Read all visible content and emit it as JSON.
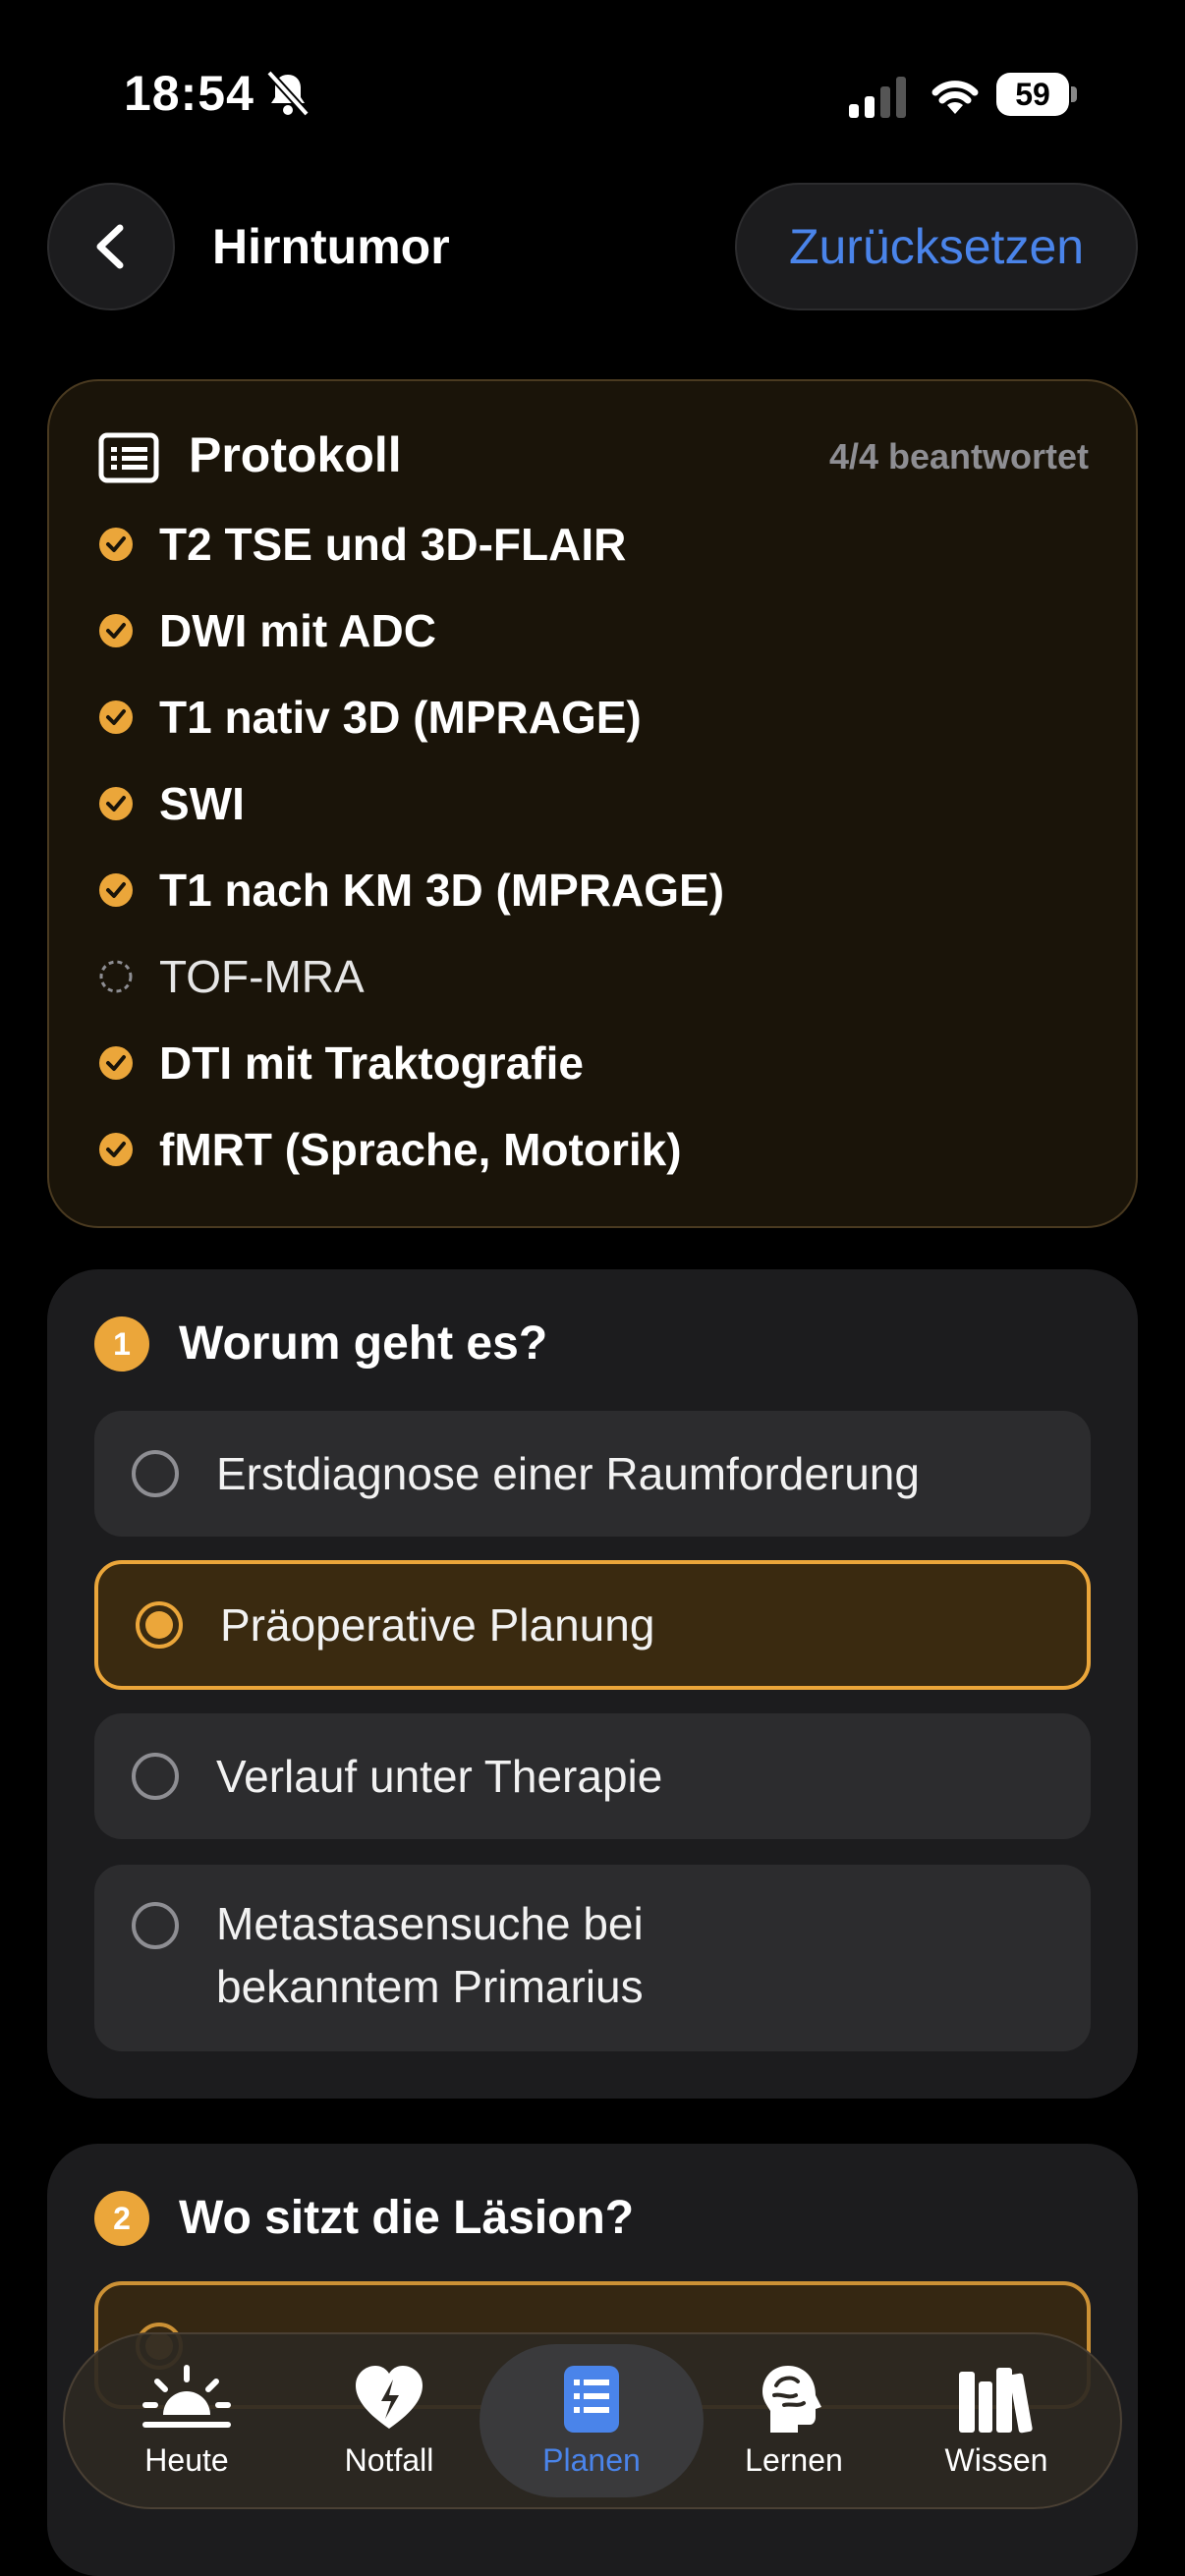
{
  "status_bar": {
    "time": "18:54",
    "battery": "59"
  },
  "nav": {
    "title": "Hirntumor",
    "reset_label": "Zurücksetzen"
  },
  "protocol": {
    "title": "Protokoll",
    "count": "4/4 beantwortet",
    "items": [
      {
        "label": "T2 TSE und 3D-FLAIR",
        "checked": true
      },
      {
        "label": "DWI mit ADC",
        "checked": true
      },
      {
        "label": "T1 nativ 3D (MPRAGE)",
        "checked": true
      },
      {
        "label": "SWI",
        "checked": true
      },
      {
        "label": "T1 nach KM 3D (MPRAGE)",
        "checked": true
      },
      {
        "label": "TOF-MRA",
        "checked": false
      },
      {
        "label": "DTI mit Traktografie",
        "checked": true
      },
      {
        "label": "fMRT (Sprache, Motorik)",
        "checked": true
      }
    ]
  },
  "question1": {
    "number": "1",
    "title": "Worum geht es?",
    "options": [
      {
        "label": "Erstdiagnose einer Raumforderung",
        "selected": false
      },
      {
        "label": "Präoperative Planung",
        "selected": true
      },
      {
        "label": "Verlauf unter Therapie",
        "selected": false
      },
      {
        "label_line1": "Metastasensuche bei",
        "label_line2": "bekanntem Primarius",
        "selected": false
      }
    ]
  },
  "question2": {
    "number": "2",
    "title": "Wo sitzt die Läsion?"
  },
  "tabbar": {
    "accent": "#4a84ea",
    "tabs": [
      {
        "label": "Heute",
        "icon": "sunrise-icon"
      },
      {
        "label": "Notfall",
        "icon": "heart-bolt-icon"
      },
      {
        "label": "Planen",
        "icon": "list-doc-icon",
        "active": true
      },
      {
        "label": "Lernen",
        "icon": "brain-head-icon"
      },
      {
        "label": "Wissen",
        "icon": "books-icon"
      }
    ]
  },
  "colors": {
    "accent_orange": "#eba63a",
    "accent_blue": "#4a84ea",
    "card": "#1c1c1e"
  }
}
